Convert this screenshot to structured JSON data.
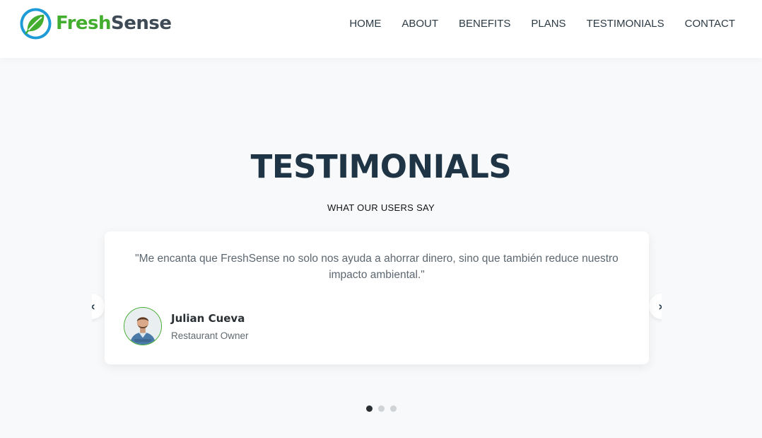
{
  "header": {
    "brand": {
      "part1": "Fresh",
      "part2": "Sense"
    },
    "nav": [
      {
        "label": "HOME"
      },
      {
        "label": "ABOUT"
      },
      {
        "label": "BENEFITS"
      },
      {
        "label": "PLANS"
      },
      {
        "label": "TESTIMONIALS"
      },
      {
        "label": "CONTACT"
      }
    ]
  },
  "section": {
    "title": "TESTIMONIALS",
    "subtitle": "WHAT OUR USERS SAY"
  },
  "testimonial": {
    "quote": "\"Me encanta que FreshSense no solo nos ayuda a ahorrar dinero, sino que también reduce nuestro impacto ambiental.\"",
    "author_name": "Julian Cueva",
    "author_role": "Restaurant Owner"
  },
  "carousel": {
    "prev_icon": "chevron-left-icon",
    "next_icon": "chevron-right-icon",
    "slide_count": 3,
    "active_index": 0
  },
  "colors": {
    "brand_green": "#43ad2f",
    "brand_blue": "#1e9bd7",
    "title_dark": "#1f3545",
    "background": "#f8f9fa"
  }
}
